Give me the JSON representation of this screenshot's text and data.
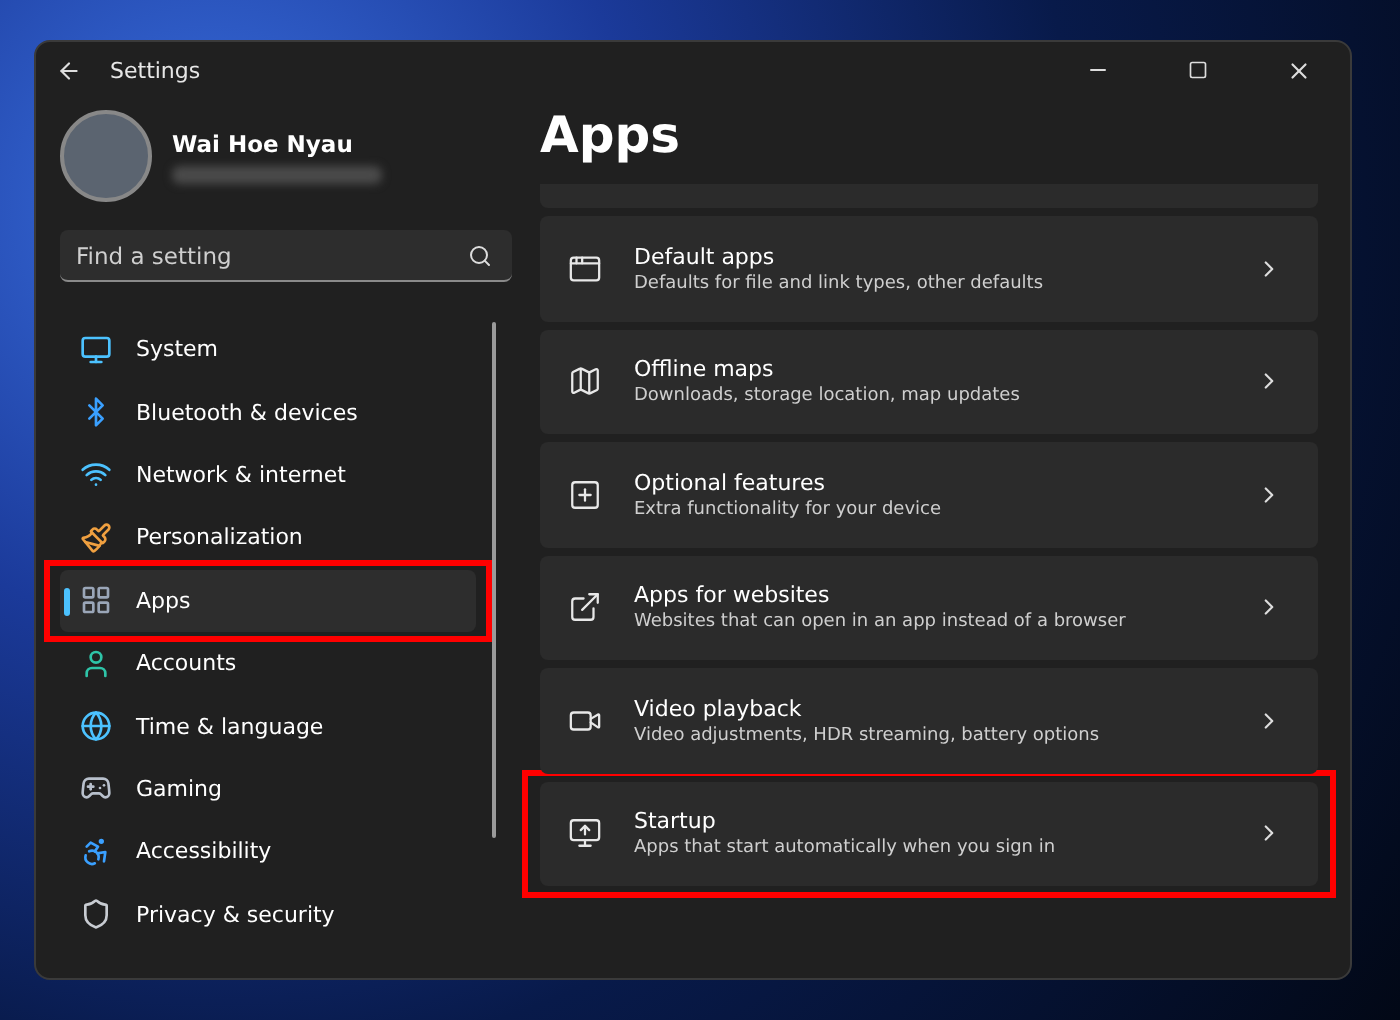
{
  "window": {
    "title": "Settings"
  },
  "user": {
    "name": "Wai Hoe Nyau"
  },
  "search": {
    "placeholder": "Find a setting"
  },
  "nav": [
    {
      "label": "System",
      "selected": false,
      "highlighted": false
    },
    {
      "label": "Bluetooth & devices",
      "selected": false,
      "highlighted": false
    },
    {
      "label": "Network & internet",
      "selected": false,
      "highlighted": false
    },
    {
      "label": "Personalization",
      "selected": false,
      "highlighted": false
    },
    {
      "label": "Apps",
      "selected": true,
      "highlighted": true
    },
    {
      "label": "Accounts",
      "selected": false,
      "highlighted": false
    },
    {
      "label": "Time & language",
      "selected": false,
      "highlighted": false
    },
    {
      "label": "Gaming",
      "selected": false,
      "highlighted": false
    },
    {
      "label": "Accessibility",
      "selected": false,
      "highlighted": false
    },
    {
      "label": "Privacy & security",
      "selected": false,
      "highlighted": false
    }
  ],
  "page": {
    "title": "Apps"
  },
  "cards": [
    {
      "title": "Default apps",
      "subtitle": "Defaults for file and link types, other defaults",
      "highlighted": false
    },
    {
      "title": "Offline maps",
      "subtitle": "Downloads, storage location, map updates",
      "highlighted": false
    },
    {
      "title": "Optional features",
      "subtitle": "Extra functionality for your device",
      "highlighted": false
    },
    {
      "title": "Apps for websites",
      "subtitle": "Websites that can open in an app instead of a browser",
      "highlighted": false
    },
    {
      "title": "Video playback",
      "subtitle": "Video adjustments, HDR streaming, battery options",
      "highlighted": false
    },
    {
      "title": "Startup",
      "subtitle": "Apps that start automatically when you sign in",
      "highlighted": true
    }
  ]
}
